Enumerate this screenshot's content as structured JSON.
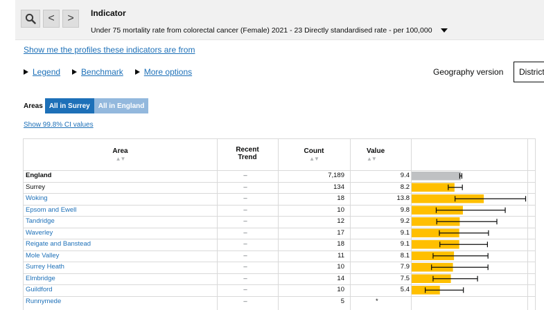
{
  "toolbar": {
    "search_icon": "magnifier",
    "back_label": "<",
    "forward_label": ">"
  },
  "indicator": {
    "title": "Indicator",
    "selected": "Under 75 mortality rate from colorectal cancer (Female)  2021 - 23  Directly standardised rate - per 100,000"
  },
  "links": {
    "profiles": "Show me the profiles these indicators are from",
    "ci_values": "Show 99.8% CI values"
  },
  "options": {
    "legend": "Legend",
    "benchmark": "Benchmark",
    "more": "More options"
  },
  "geography": {
    "label": "Geography version",
    "value": "District"
  },
  "areas": {
    "label": "Areas",
    "buttons": [
      "All in Surrey",
      "All in England"
    ]
  },
  "table": {
    "headers": {
      "area": "Area",
      "trend": [
        "Recent",
        "Trend"
      ],
      "count": "Count",
      "value": "Value",
      "sort_arrows": "▲▼"
    }
  },
  "colors": {
    "accent": "#1d70b8",
    "bar_benchmark": "#bfc1c3",
    "bar_similar": "#ffbf00"
  },
  "chart_data": {
    "type": "bar",
    "orientation": "horizontal",
    "categories": [
      "England",
      "Surrey",
      "Woking",
      "Epsom and Ewell",
      "Tandridge",
      "Waverley",
      "Reigate and Banstead",
      "Mole Valley",
      "Surrey Heath",
      "Elmbridge",
      "Guildford",
      "Runnymede"
    ],
    "trend": [
      "–",
      "–",
      "–",
      "–",
      "–",
      "–",
      "–",
      "–",
      "–",
      "–",
      "–",
      "–"
    ],
    "counts": [
      "7,189",
      "134",
      "18",
      "10",
      "12",
      "17",
      "18",
      "11",
      "10",
      "14",
      "10",
      "5"
    ],
    "value_labels": [
      "9.4",
      "8.2",
      "13.8",
      "9.8",
      "9.2",
      "9.1",
      "9.1",
      "8.1",
      "7.9",
      "7.5",
      "5.4",
      "*"
    ],
    "values": [
      9.4,
      8.2,
      13.8,
      9.8,
      9.2,
      9.1,
      9.1,
      8.1,
      7.9,
      7.5,
      5.4,
      null
    ],
    "ci_lower": [
      9.2,
      7.0,
      8.3,
      4.7,
      4.8,
      5.3,
      5.4,
      4.1,
      3.8,
      4.1,
      2.6,
      null
    ],
    "ci_upper": [
      9.6,
      9.7,
      21.8,
      17.9,
      16.3,
      14.7,
      14.5,
      14.6,
      14.6,
      12.6,
      9.9,
      null
    ],
    "bar_colors": [
      "#bfc1c3",
      "#ffbf00",
      "#ffbf00",
      "#ffbf00",
      "#ffbf00",
      "#ffbf00",
      "#ffbf00",
      "#ffbf00",
      "#ffbf00",
      "#ffbf00",
      "#ffbf00",
      null
    ],
    "xlim": [
      0,
      22
    ],
    "styles": [
      "bold",
      "plain",
      "link",
      "link",
      "link",
      "link",
      "link",
      "link",
      "link",
      "link",
      "link",
      "link"
    ]
  }
}
